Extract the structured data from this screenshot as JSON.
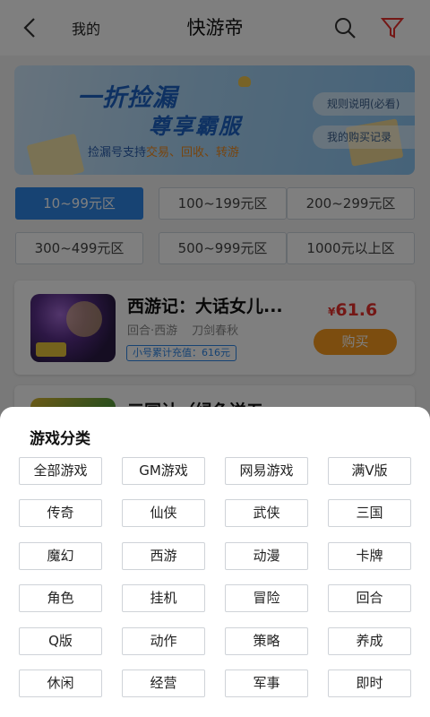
{
  "header": {
    "back_icon": "chevron-left-icon",
    "mine": "我的",
    "title": "快游帝",
    "search_icon": "search-icon",
    "filter_icon": "funnel-icon",
    "filter_color": "#e8302c"
  },
  "banner": {
    "line1": "一折捡漏",
    "line2": "尊享霸服",
    "line3_prefix": "捡漏号支持",
    "line3_highlight": "交易、回收、转游",
    "rules": "规则说明(必看)",
    "records": "我的购买记录"
  },
  "price_ranges": [
    "10~99元区",
    "100~199元区",
    "200~299元区",
    "300~499元区",
    "500~999元区",
    "1000元以上区"
  ],
  "selected_price_range": "10~99元区",
  "games": [
    {
      "name": "西游记：大话女儿...",
      "tags": [
        "回合·西游",
        "刀剑春秋"
      ],
      "recharge": "小号累计充值：616元",
      "currency": "¥",
      "price": "61.6",
      "buy": "购买"
    },
    {
      "name": "三国计（绿色送五"
    }
  ],
  "category_sheet": {
    "title": "游戏分类",
    "categories": [
      "全部游戏",
      "GM游戏",
      "网易游戏",
      "满V版",
      "传奇",
      "仙侠",
      "武侠",
      "三国",
      "魔幻",
      "西游",
      "动漫",
      "卡牌",
      "角色",
      "挂机",
      "冒险",
      "回合",
      "Q版",
      "动作",
      "策略",
      "养成",
      "休闲",
      "经营",
      "军事",
      "即时"
    ]
  },
  "colors": {
    "accent": "#2e86e6",
    "price": "#e8302c",
    "buy": "#f89a1f"
  }
}
